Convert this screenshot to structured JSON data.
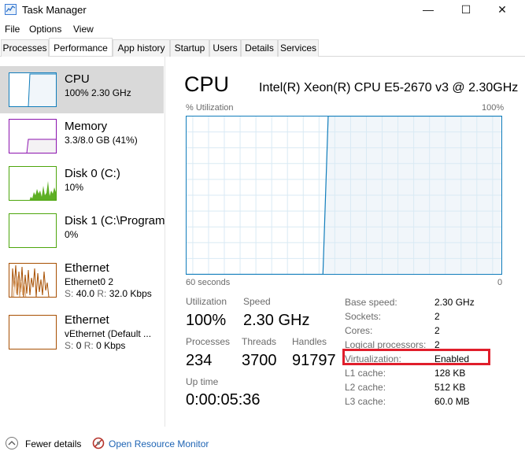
{
  "window": {
    "title": "Task Manager",
    "minimize": "—",
    "maximize": "☐",
    "close": "✕"
  },
  "menu": [
    "File",
    "Options",
    "View"
  ],
  "tabs": [
    "Processes",
    "Performance",
    "App history",
    "Startup",
    "Users",
    "Details",
    "Services"
  ],
  "active_tab": "Performance",
  "sidebar": {
    "items": [
      {
        "title": "CPU",
        "line1": "100%  2.30 GHz",
        "line2": "",
        "color": "#117dbb",
        "icon": "cpu-graph-icon"
      },
      {
        "title": "Memory",
        "line1": "3.3/8.0 GB (41%)",
        "line2": "",
        "color": "#8b12ae",
        "icon": "memory-graph-icon"
      },
      {
        "title": "Disk 0 (C:)",
        "line1": "10%",
        "line2": "",
        "color": "#4da60c",
        "icon": "disk-graph-icon"
      },
      {
        "title": "Disk 1 (C:\\Program",
        "line1": "0%",
        "line2": "",
        "color": "#4da60c",
        "icon": "disk-graph-icon"
      },
      {
        "title": "Ethernet",
        "line1": "Ethernet0 2",
        "line2_s_label": "S:",
        "line2_s": "40.0",
        "line2_r_label": "R:",
        "line2_r": "32.0 Kbps",
        "color": "#a74f01",
        "icon": "ethernet-graph-icon"
      },
      {
        "title": "Ethernet",
        "line1": "vEthernet (Default ...",
        "line2_s_label": "S:",
        "line2_s": "0",
        "line2_r_label": "R:",
        "line2_r": "0 Kbps",
        "color": "#a74f01",
        "icon": "ethernet-graph-icon"
      }
    ]
  },
  "cpu": {
    "heading": "CPU",
    "model": "Intel(R) Xeon(R) CPU E5-2670 v3 @ 2.30GHz",
    "graph_label_left": "% Utilization",
    "graph_label_right": "100%",
    "graph_time_left": "60 seconds",
    "graph_time_right": "0",
    "graph_color": "#117dbb",
    "graph_fill": "#f1f6fa",
    "graph_history_percent": [
      0,
      0,
      0,
      0,
      0,
      0,
      0,
      0,
      0,
      0,
      0,
      0,
      0,
      0,
      0,
      0,
      0,
      0,
      0,
      0,
      0,
      0,
      0,
      0,
      0,
      0,
      0,
      100,
      100,
      100,
      100,
      100,
      100,
      100,
      100,
      100,
      100,
      100,
      100,
      100,
      100,
      100,
      100,
      100,
      100,
      100,
      100,
      100,
      100,
      100,
      100,
      100,
      100,
      100,
      100,
      100,
      100,
      100,
      100,
      100,
      100
    ],
    "stats": {
      "utilization_label": "Utilization",
      "utilization": "100%",
      "speed_label": "Speed",
      "speed": "2.30 GHz",
      "processes_label": "Processes",
      "processes": "234",
      "threads_label": "Threads",
      "threads": "3700",
      "handles_label": "Handles",
      "handles": "91797",
      "uptime_label": "Up time",
      "uptime": "0:00:05:36"
    },
    "details": [
      {
        "key": "Base speed:",
        "value": "2.30 GHz"
      },
      {
        "key": "Sockets:",
        "value": "2"
      },
      {
        "key": "Cores:",
        "value": "2"
      },
      {
        "key": "Logical processors:",
        "value": "2"
      },
      {
        "key": "Virtualization:",
        "value": "Enabled"
      },
      {
        "key": "L1 cache:",
        "value": "128 KB"
      },
      {
        "key": "L2 cache:",
        "value": "512 KB"
      },
      {
        "key": "L3 cache:",
        "value": "60.0 MB"
      }
    ],
    "highlight_color": "#e01e2b"
  },
  "footer": {
    "fewer_details": "Fewer details",
    "resource_monitor": "Open Resource Monitor"
  }
}
